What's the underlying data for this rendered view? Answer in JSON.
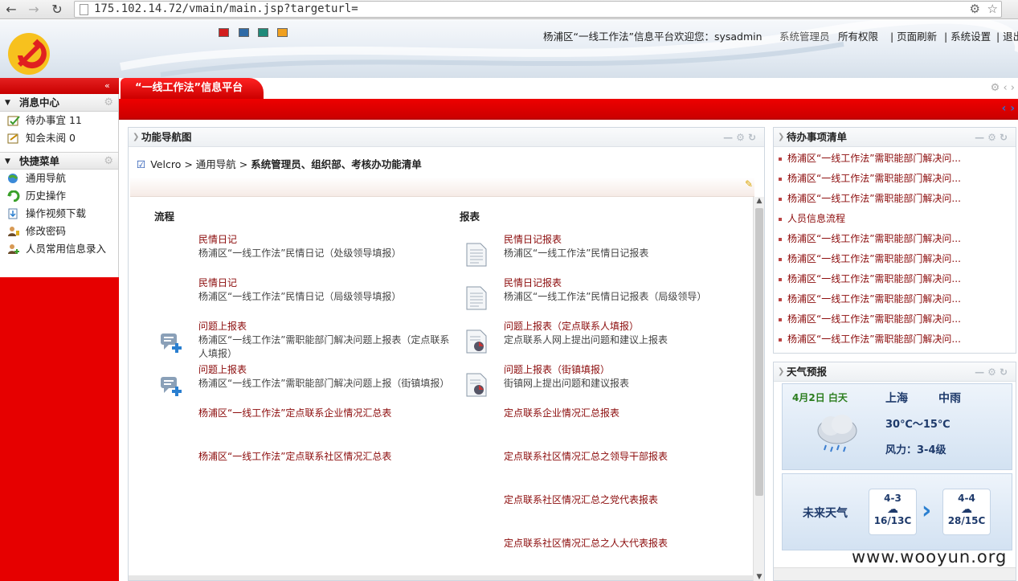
{
  "browser": {
    "url": "175.102.14.72/vmain/main.jsp?targeturl=",
    "back_icon": "arrow-left-icon",
    "forward_icon": "arrow-right-icon",
    "reload_icon": "reload-icon"
  },
  "header": {
    "welcome": "杨浦区“一线工作法”信息平台欢迎您：sysadmin",
    "role": "系统管理员",
    "links": [
      "所有权限",
      "| 页面刷新",
      "| 系统设置",
      "| 退出"
    ],
    "skin_colors": [
      "#d21d1d",
      "#2f6aa6",
      "#1f8a7a",
      "#f0a020"
    ]
  },
  "tab": {
    "label": "“一线工作法”信息平台",
    "collapse": "«"
  },
  "sidebar": {
    "sections": [
      {
        "title": "消息中心",
        "items": [
          {
            "label": "待办事宜 11",
            "icon": "todo-icon"
          },
          {
            "label": "知会未阅 0",
            "icon": "notice-icon"
          }
        ]
      },
      {
        "title": "快捷菜单",
        "items": [
          {
            "label": "通用导航",
            "icon": "navigation-icon"
          },
          {
            "label": "历史操作",
            "icon": "history-icon"
          },
          {
            "label": "操作视频下载",
            "icon": "download-icon"
          },
          {
            "label": "修改密码",
            "icon": "user-key-icon"
          },
          {
            "label": "人员常用信息录入",
            "icon": "user-add-icon"
          }
        ]
      }
    ]
  },
  "center": {
    "title": "功能导航图",
    "breadcrumb": {
      "root": "Velcro",
      "sep1": " > ",
      "mid": "通用导航",
      "sep2": " > ",
      "current": "系统管理员、组织部、考核办功能清单"
    },
    "col_flow": "流程",
    "col_report": "报表",
    "flow": [
      {
        "title": "民情日记",
        "desc": "杨浦区“一线工作法”民情日记（处级领导填报）"
      },
      {
        "title": "民情日记",
        "desc": "杨浦区“一线工作法”民情日记（局级领导填报）"
      },
      {
        "title": "问题上报表",
        "desc": "杨浦区“一线工作法”需职能部门解决问题上报表（定点联系人填报）"
      },
      {
        "title": "问题上报表",
        "desc": "杨浦区“一线工作法”需职能部门解决问题上报（街镇填报）"
      },
      {
        "title": "杨浦区“一线工作法”定点联系企业情况汇总表",
        "desc": ""
      },
      {
        "title": "杨浦区“一线工作法”定点联系社区情况汇总表",
        "desc": ""
      }
    ],
    "reports": [
      {
        "title": "民情日记报表",
        "desc": "杨浦区“一线工作法”民情日记报表"
      },
      {
        "title": "民情日记报表",
        "desc": "杨浦区“一线工作法”民情日记报表（局级领导）"
      },
      {
        "title": "问题上报表（定点联系人填报）",
        "desc": "定点联系人网上提出问题和建议上报表"
      },
      {
        "title": "问题上报表（街镇填报）",
        "desc": "街镇网上提出问题和建议报表"
      },
      {
        "title": "定点联系企业情况汇总报表",
        "desc": ""
      },
      {
        "title": "定点联系社区情况汇总之领导干部报表",
        "desc": ""
      },
      {
        "title": "定点联系社区情况汇总之党代表报表",
        "desc": ""
      },
      {
        "title": "定点联系社区情况汇总之人大代表报表",
        "desc": ""
      }
    ]
  },
  "todo": {
    "title": "待办事项清单",
    "items": [
      "杨浦区“一线工作法”需职能部门解决问...",
      "杨浦区“一线工作法”需职能部门解决问...",
      "杨浦区“一线工作法”需职能部门解决问...",
      "人员信息流程",
      "杨浦区“一线工作法”需职能部门解决问...",
      "杨浦区“一线工作法”需职能部门解决问...",
      "杨浦区“一线工作法”需职能部门解决问...",
      "杨浦区“一线工作法”需职能部门解决问...",
      "杨浦区“一线工作法”需职能部门解决问...",
      "杨浦区“一线工作法”需职能部门解决问..."
    ]
  },
  "weather": {
    "title": "天气预报",
    "date": "4月2日 白天",
    "city": "上海",
    "condition": "中雨",
    "temp": "30℃～15℃",
    "wind": "风力：3-4级",
    "future_label": "未来天气",
    "forecast": [
      {
        "date": "4-3",
        "temp": "16/13C"
      },
      {
        "date": "4-4",
        "temp": "28/15C"
      }
    ]
  },
  "watermark": "www.wooyun.org"
}
